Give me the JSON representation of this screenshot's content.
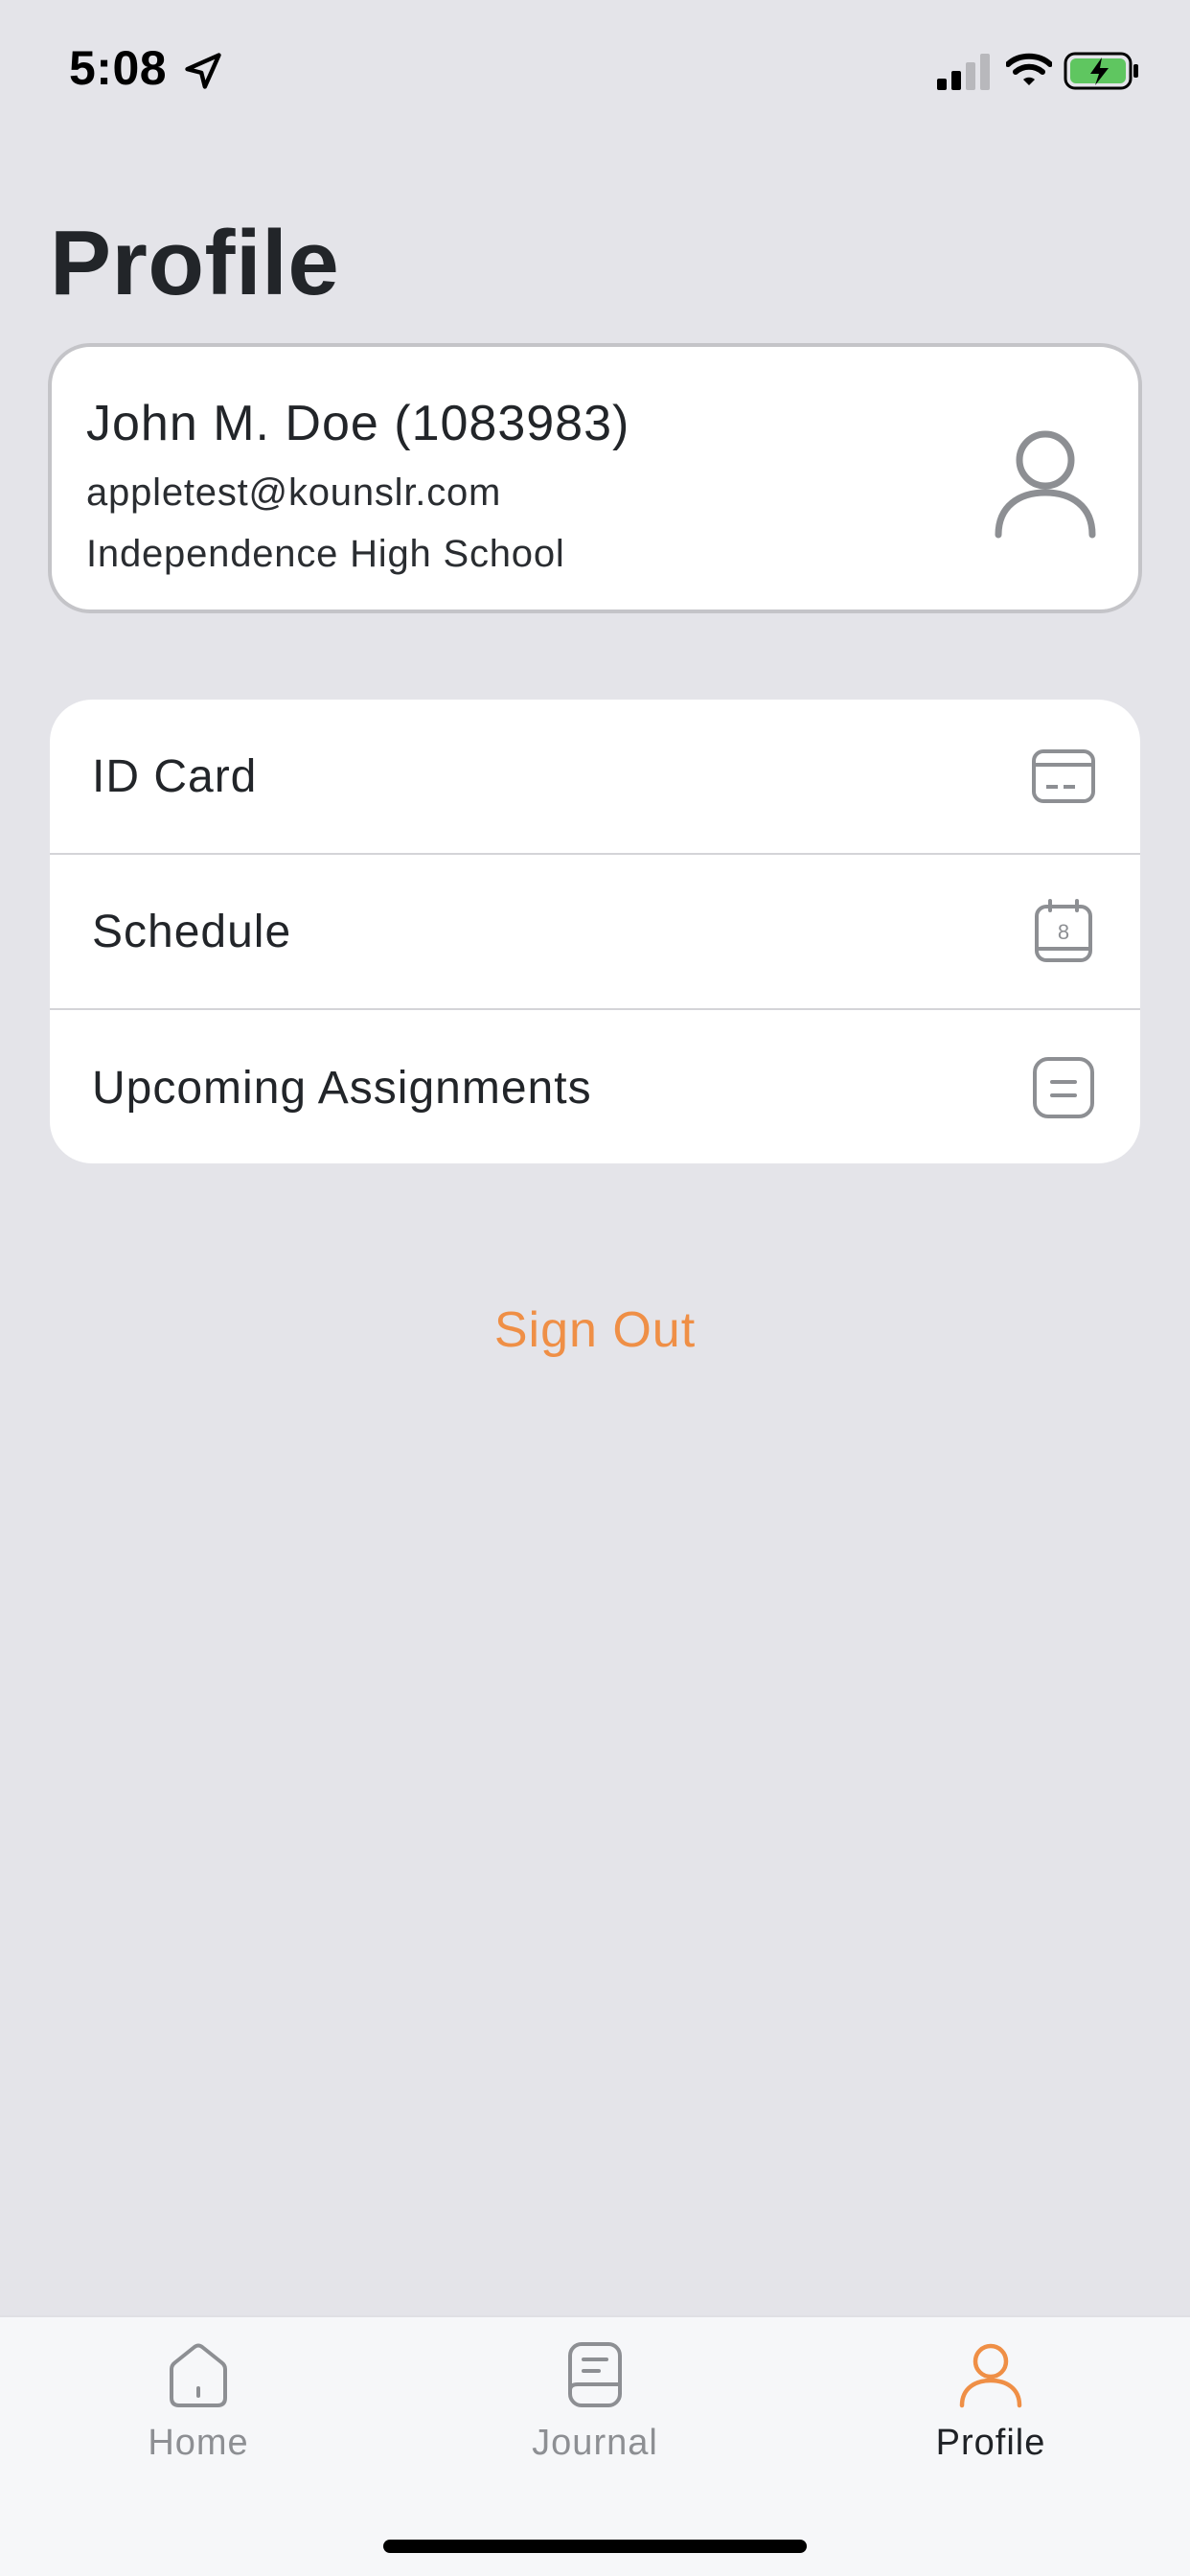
{
  "status_bar": {
    "time": "5:08"
  },
  "header": {
    "title": "Profile"
  },
  "profile": {
    "name": "John M. Doe (1083983)",
    "email": "appletest@kounslr.com",
    "school": "Independence High School",
    "avatar_icon": "person-icon"
  },
  "menu": {
    "items": [
      {
        "label": "ID Card",
        "icon": "id-card-icon"
      },
      {
        "label": "Schedule",
        "icon": "calendar-icon",
        "icon_text": "8"
      },
      {
        "label": "Upcoming Assignments",
        "icon": "assignments-icon"
      }
    ]
  },
  "actions": {
    "sign_out": "Sign Out"
  },
  "tab_bar": {
    "tabs": [
      {
        "label": "Home",
        "icon": "home-icon"
      },
      {
        "label": "Journal",
        "icon": "journal-icon"
      },
      {
        "label": "Profile",
        "icon": "profile-icon",
        "active": true
      }
    ]
  },
  "colors": {
    "accent": "#ef8f46",
    "background": "#e4e4e9",
    "card": "#ffffff",
    "icon_gray": "#8d8f93"
  }
}
